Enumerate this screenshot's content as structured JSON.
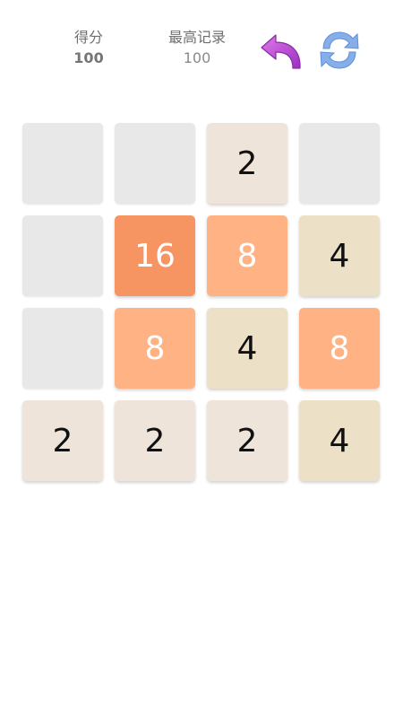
{
  "header": {
    "score_label": "得分",
    "score_value": "100",
    "best_label": "最高记录",
    "best_value": "100",
    "undo_icon": "undo-arrow-icon",
    "refresh_icon": "refresh-icon",
    "undo_color": "#c04ad6",
    "refresh_color": "#7aa8e8"
  },
  "board": {
    "rows": [
      [
        "",
        "",
        "2",
        ""
      ],
      [
        "",
        "16",
        "8",
        "4"
      ],
      [
        "",
        "8",
        "4",
        "8"
      ],
      [
        "2",
        "2",
        "2",
        "4"
      ]
    ]
  }
}
